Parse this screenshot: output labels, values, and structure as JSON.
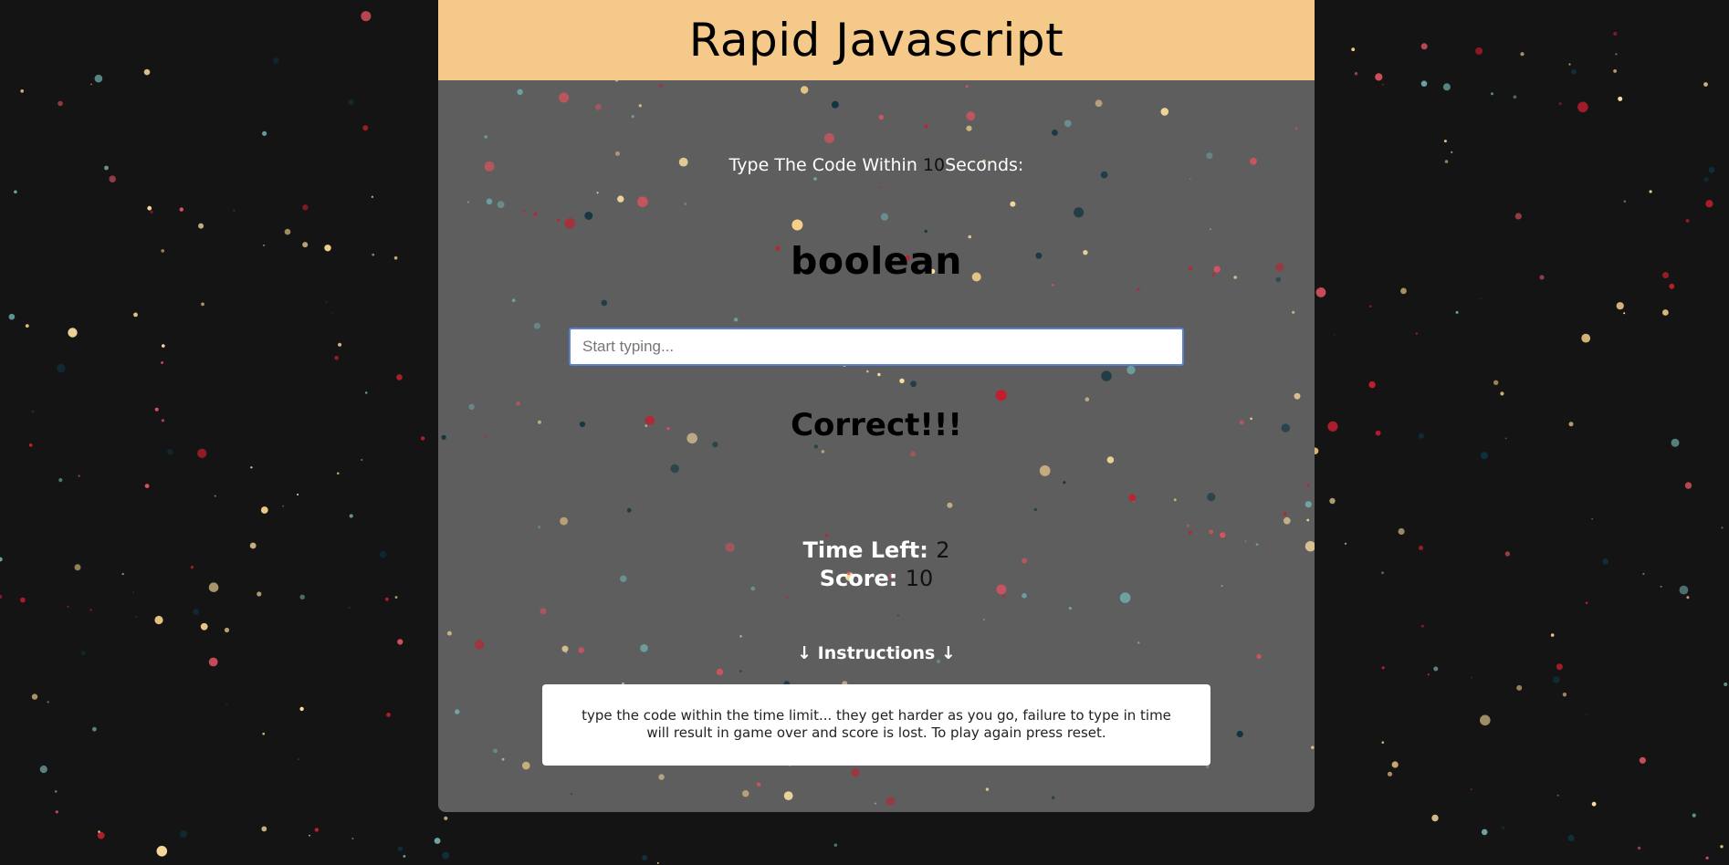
{
  "header": {
    "title": "Rapid Javascript"
  },
  "game": {
    "prompt_before": "Type The Code Within ",
    "prompt_seconds": "10",
    "prompt_after": "Seconds:",
    "current_word": "boolean",
    "input_placeholder": "Start typing...",
    "input_value": "",
    "message": "Correct!!!",
    "time_left_label": "Time Left:",
    "time_left_value": "2",
    "score_label": "Score:",
    "score_value": "10"
  },
  "instructions": {
    "heading": "↓ Instructions ↓",
    "text": "type the code within the time limit... they get harder as you go, failure to type in time will result in game over and score is lost. To play again press reset."
  },
  "colors": {
    "page_background": "#141415",
    "panel_background": "#5e5e5e",
    "header_background": "#f4c98a",
    "particle_colors": [
      "#f6d08a",
      "#c41e2e",
      "#6fa7a6",
      "#d9525f",
      "#0e3340",
      "#ffe0a0"
    ],
    "input_border": "#5b7fd6"
  }
}
